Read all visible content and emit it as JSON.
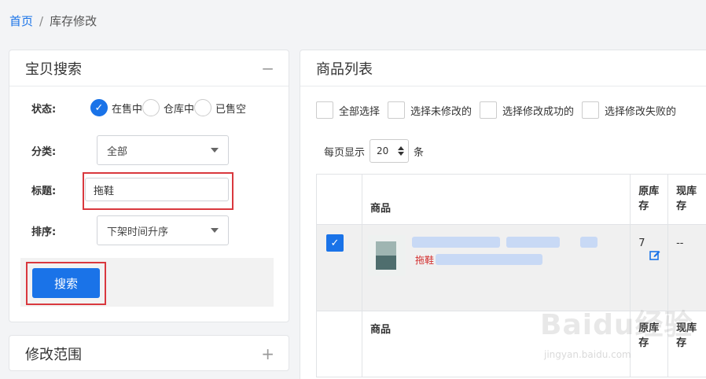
{
  "breadcrumb": {
    "home": "首页",
    "separator": "/",
    "current": "库存修改"
  },
  "search_panel": {
    "title": "宝贝搜索",
    "collapse_icon": "minus-icon",
    "status": {
      "label": "状态:",
      "options": [
        "在售中",
        "仓库中",
        "已售空"
      ],
      "selected": "在售中"
    },
    "category": {
      "label": "分类:",
      "value": "全部"
    },
    "title_field": {
      "label": "标题:",
      "value": "拖鞋"
    },
    "sort": {
      "label": "排序:",
      "value": "下架时间升序"
    },
    "search_button": "搜索",
    "highlight_color": "#d9383e",
    "accent_color": "#1a73e8"
  },
  "range_panel": {
    "title": "修改范围",
    "expand_icon": "plus-icon"
  },
  "list_panel": {
    "title": "商品列表",
    "filters": [
      "全部选择",
      "选择未修改的",
      "选择修改成功的",
      "选择修改失败的"
    ],
    "per_page": {
      "label": "每页显示",
      "value": "20",
      "unit": "条"
    },
    "columns": {
      "product": "商品",
      "original_stock": "原库存",
      "current_stock": "现库存"
    },
    "rows": [
      {
        "checked": true,
        "product_name": "拖鞋",
        "original_stock": "7",
        "current_stock": "--"
      }
    ],
    "footer_columns": {
      "product": "商品",
      "original_stock": "原库存",
      "current_stock": "现库存"
    }
  },
  "watermark": {
    "text": "Baidu经验",
    "sub": "jingyan.baidu.com"
  }
}
